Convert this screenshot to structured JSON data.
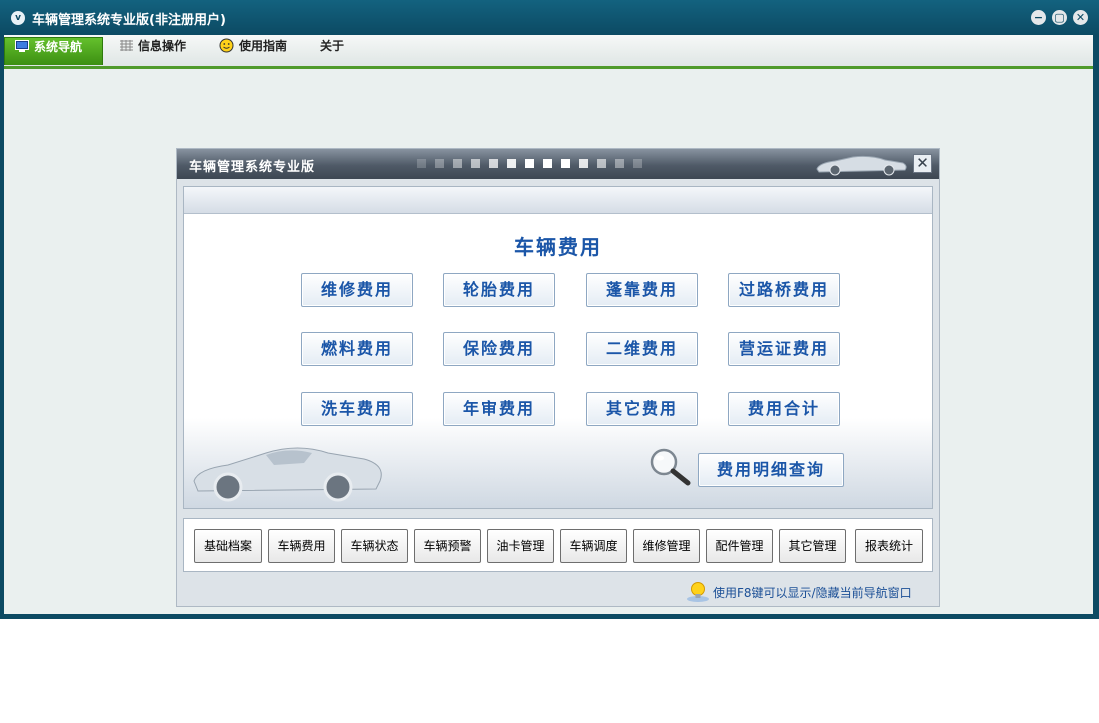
{
  "window": {
    "icon_glyph": "v",
    "title": "车辆管理系统专业版(非注册用户)",
    "controls": [
      "−",
      "▢",
      "✕"
    ]
  },
  "menu": {
    "items": [
      {
        "label": "系统导航",
        "icon": "monitor-icon",
        "active": true
      },
      {
        "label": "信息操作",
        "icon": "grid-icon",
        "active": false
      },
      {
        "label": "使用指南",
        "icon": "smiley-icon",
        "active": false
      },
      {
        "label": "关于",
        "icon": "",
        "active": false
      }
    ],
    "accent": "#4f9a2b"
  },
  "panel": {
    "title": "车辆管理系统专业版",
    "close_glyph": "✕",
    "section_title": "车辆费用",
    "fee_buttons": [
      [
        "维修费用",
        "轮胎费用",
        "蓬靠费用",
        "过路桥费用"
      ],
      [
        "燃料费用",
        "保险费用",
        "二维费用",
        "营运证费用"
      ],
      [
        "洗车费用",
        "年审费用",
        "其它费用",
        "费用合计"
      ]
    ],
    "detail_query": "费用明细查询",
    "quick_buttons": [
      "基础档案",
      "车辆费用",
      "车辆状态",
      "车辆预警",
      "油卡管理",
      "车辆调度",
      "维修管理",
      "配件管理",
      "其它管理",
      "报表统计"
    ],
    "tip": "使用F8键可以显示/隐藏当前导航窗口"
  }
}
